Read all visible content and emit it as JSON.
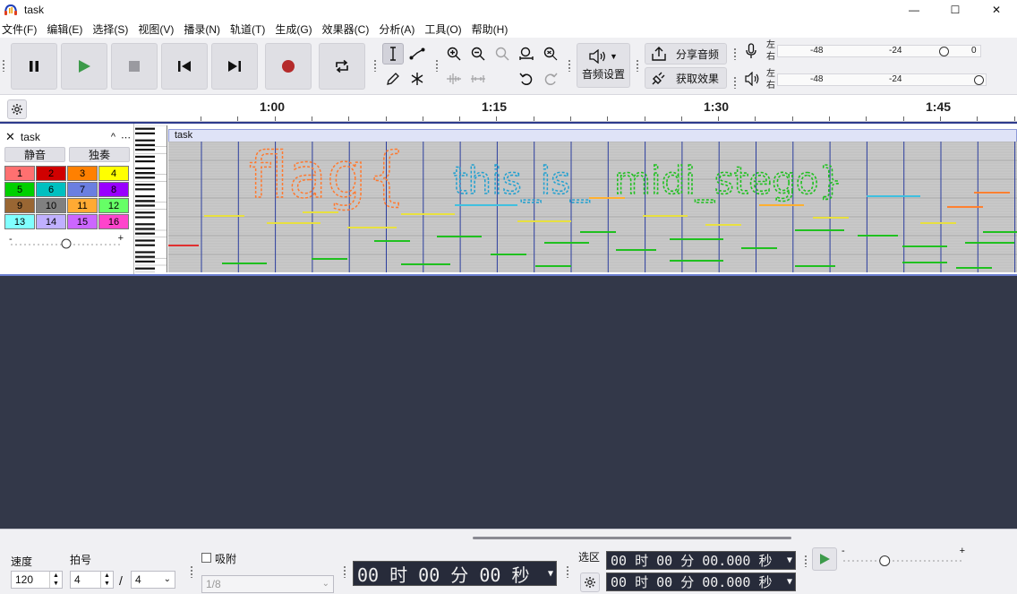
{
  "window": {
    "title": "task",
    "minimize": "—",
    "maximize": "☐",
    "close": "✕"
  },
  "menu": [
    "文件(F)",
    "编辑(E)",
    "选择(S)",
    "视图(V)",
    "播录(N)",
    "轨道(T)",
    "生成(G)",
    "效果器(C)",
    "分析(A)",
    "工具(O)",
    "帮助(H)"
  ],
  "toolbar": {
    "audio_setup_label": "音频设置",
    "share_audio_label": "分享音频",
    "get_effects_label": "获取效果",
    "record_meter": {
      "left": "左",
      "right": "右",
      "marks": [
        "-48",
        "-24",
        "0"
      ],
      "level": 0.88
    },
    "play_meter": {
      "left": "左",
      "right": "右",
      "marks": [
        "-48",
        "-24"
      ],
      "level": 1.0
    },
    "colors": {
      "record": "#b52b2b",
      "play": "#3c9a4a"
    }
  },
  "ruler": {
    "labels": [
      "1:00",
      "1:15",
      "1:30",
      "1:45"
    ]
  },
  "track": {
    "name": "task",
    "mute_label": "静音",
    "solo_label": "独奏",
    "clip_title": "task",
    "channels": [
      {
        "n": "1",
        "color": "#ff7070"
      },
      {
        "n": "2",
        "color": "#d00000"
      },
      {
        "n": "3",
        "color": "#ff8000"
      },
      {
        "n": "4",
        "color": "#ffff00"
      },
      {
        "n": "5",
        "color": "#00d000"
      },
      {
        "n": "6",
        "color": "#00c0c0"
      },
      {
        "n": "7",
        "color": "#6b7fe0"
      },
      {
        "n": "8",
        "color": "#9900ff"
      },
      {
        "n": "9",
        "color": "#996633"
      },
      {
        "n": "10",
        "color": "#808080"
      },
      {
        "n": "11",
        "color": "#ffaa33"
      },
      {
        "n": "12",
        "color": "#66ff66"
      },
      {
        "n": "13",
        "color": "#80ffff"
      },
      {
        "n": "14",
        "color": "#c0b0ff"
      },
      {
        "n": "15",
        "color": "#cc66ff"
      },
      {
        "n": "16",
        "color": "#ff44cc"
      }
    ],
    "velocity_minus": "-",
    "velocity_plus": "+",
    "velocity_level": 0.5
  },
  "bottom": {
    "tempo_label": "速度",
    "tempo_value": "120",
    "meter_label": "拍号",
    "meter_num": "4",
    "meter_slash": "/",
    "meter_den": "4",
    "snap_label": "吸附",
    "snap_value": "1/8",
    "time_display": "00 时 00 分 00 秒",
    "selection_label": "选区",
    "sel_start": "00 时 00 分 00.000 秒",
    "sel_end": "00 时 00 分 00.000 秒",
    "speed_minus": "-",
    "speed_plus": "+",
    "speed_level": 0.34
  }
}
